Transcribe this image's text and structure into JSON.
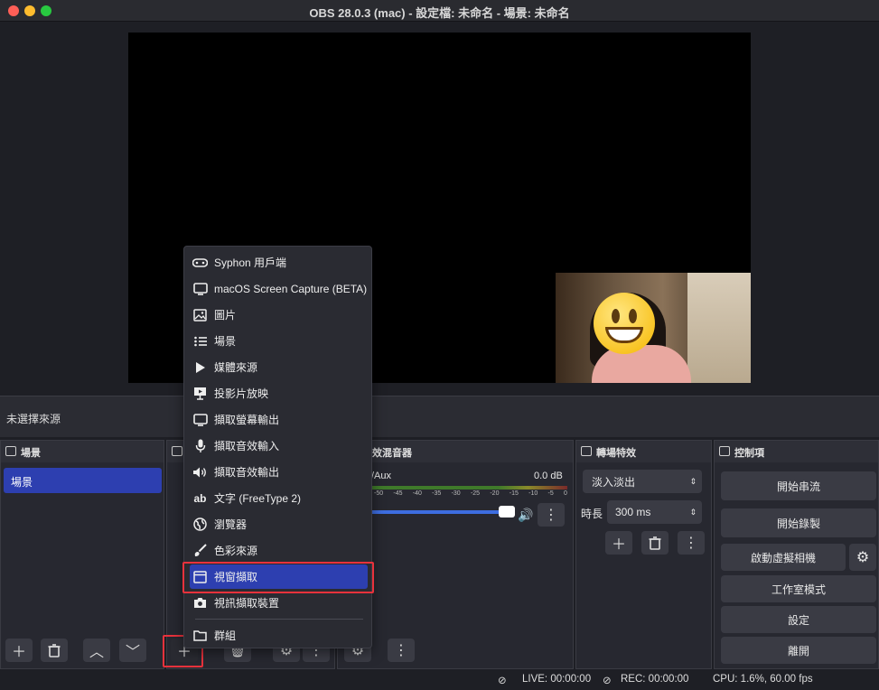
{
  "window": {
    "title": "OBS 28.0.3 (mac) - 設定檔: 未命名 - 場景: 未命名"
  },
  "source_bar": {
    "text": "未選擇來源"
  },
  "scenes": {
    "header": "場景",
    "items": [
      "場景"
    ]
  },
  "mixer": {
    "header": "效混音器",
    "channel": "/Aux",
    "level": "0.0 dB",
    "ticks": [
      "-50",
      "-45",
      "-40",
      "-35",
      "-30",
      "-25",
      "-20",
      "-15",
      "-10",
      "-5",
      "0"
    ]
  },
  "transitions": {
    "header": "轉場特效",
    "selected": "淡入淡出",
    "duration_label": "時長",
    "duration_value": "300 ms"
  },
  "controls": {
    "header": "控制項",
    "start_streaming": "開始串流",
    "start_recording": "開始錄製",
    "virtual_camera": "啟動虛擬相機",
    "studio_mode": "工作室模式",
    "settings": "設定",
    "exit": "離開"
  },
  "add_source_menu": {
    "items": [
      {
        "label": "Syphon 用戶端",
        "icon": "gamepad-icon"
      },
      {
        "label": "macOS Screen Capture (BETA)",
        "icon": "monitor-icon"
      },
      {
        "label": "圖片",
        "icon": "image-icon"
      },
      {
        "label": "場景",
        "icon": "list-icon"
      },
      {
        "label": "媒體來源",
        "icon": "play-icon"
      },
      {
        "label": "投影片放映",
        "icon": "slideshow-icon"
      },
      {
        "label": "擷取螢幕輸出",
        "icon": "monitor-icon"
      },
      {
        "label": "擷取音效輸入",
        "icon": "microphone-icon"
      },
      {
        "label": "擷取音效輸出",
        "icon": "speaker-icon"
      },
      {
        "label": "文字 (FreeType 2)",
        "icon": "text-icon"
      },
      {
        "label": "瀏覽器",
        "icon": "globe-icon"
      },
      {
        "label": "色彩來源",
        "icon": "brush-icon"
      },
      {
        "label": "視窗擷取",
        "icon": "window-icon"
      },
      {
        "label": "視訊擷取裝置",
        "icon": "camera-icon"
      },
      {
        "label": "群組",
        "icon": "folder-icon"
      }
    ],
    "selected_index": 12
  },
  "status": {
    "live": "LIVE: 00:00:00",
    "rec": "REC: 00:00:00",
    "cpu": "CPU: 1.6%, 60.00 fps"
  },
  "colors": {
    "accent": "#2d3fb0",
    "highlight": "#e8323c"
  }
}
